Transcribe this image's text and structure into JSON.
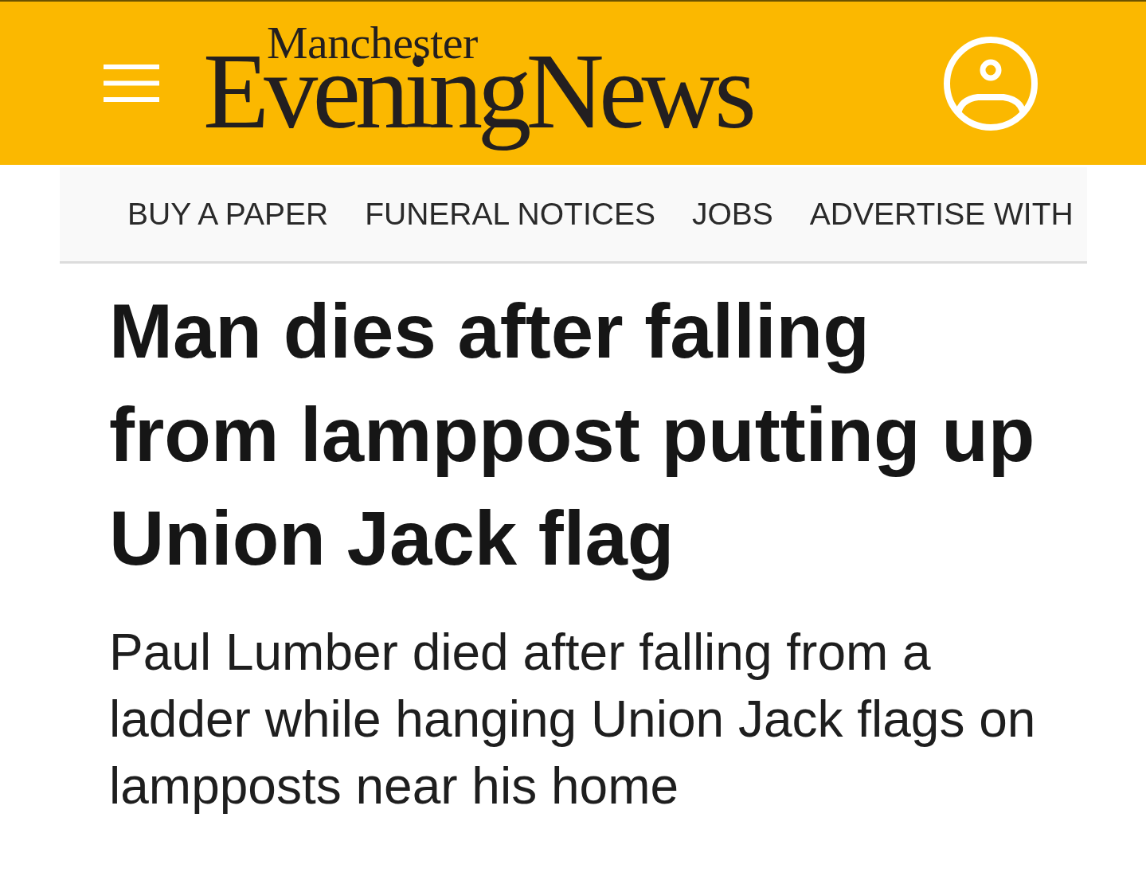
{
  "header": {
    "logo": {
      "line_1": "Manchester",
      "line_2": "EveningNews"
    }
  },
  "nav": {
    "items": [
      "BUY A PAPER",
      "FUNERAL NOTICES",
      "JOBS",
      "ADVERTISE WITH"
    ]
  },
  "article": {
    "headline": "Man dies after falling from lamppost putting up Union Jack flag",
    "standfirst": "Paul Lumber died after falling from a ladder while hanging Union Jack flags on lampposts near his home"
  }
}
